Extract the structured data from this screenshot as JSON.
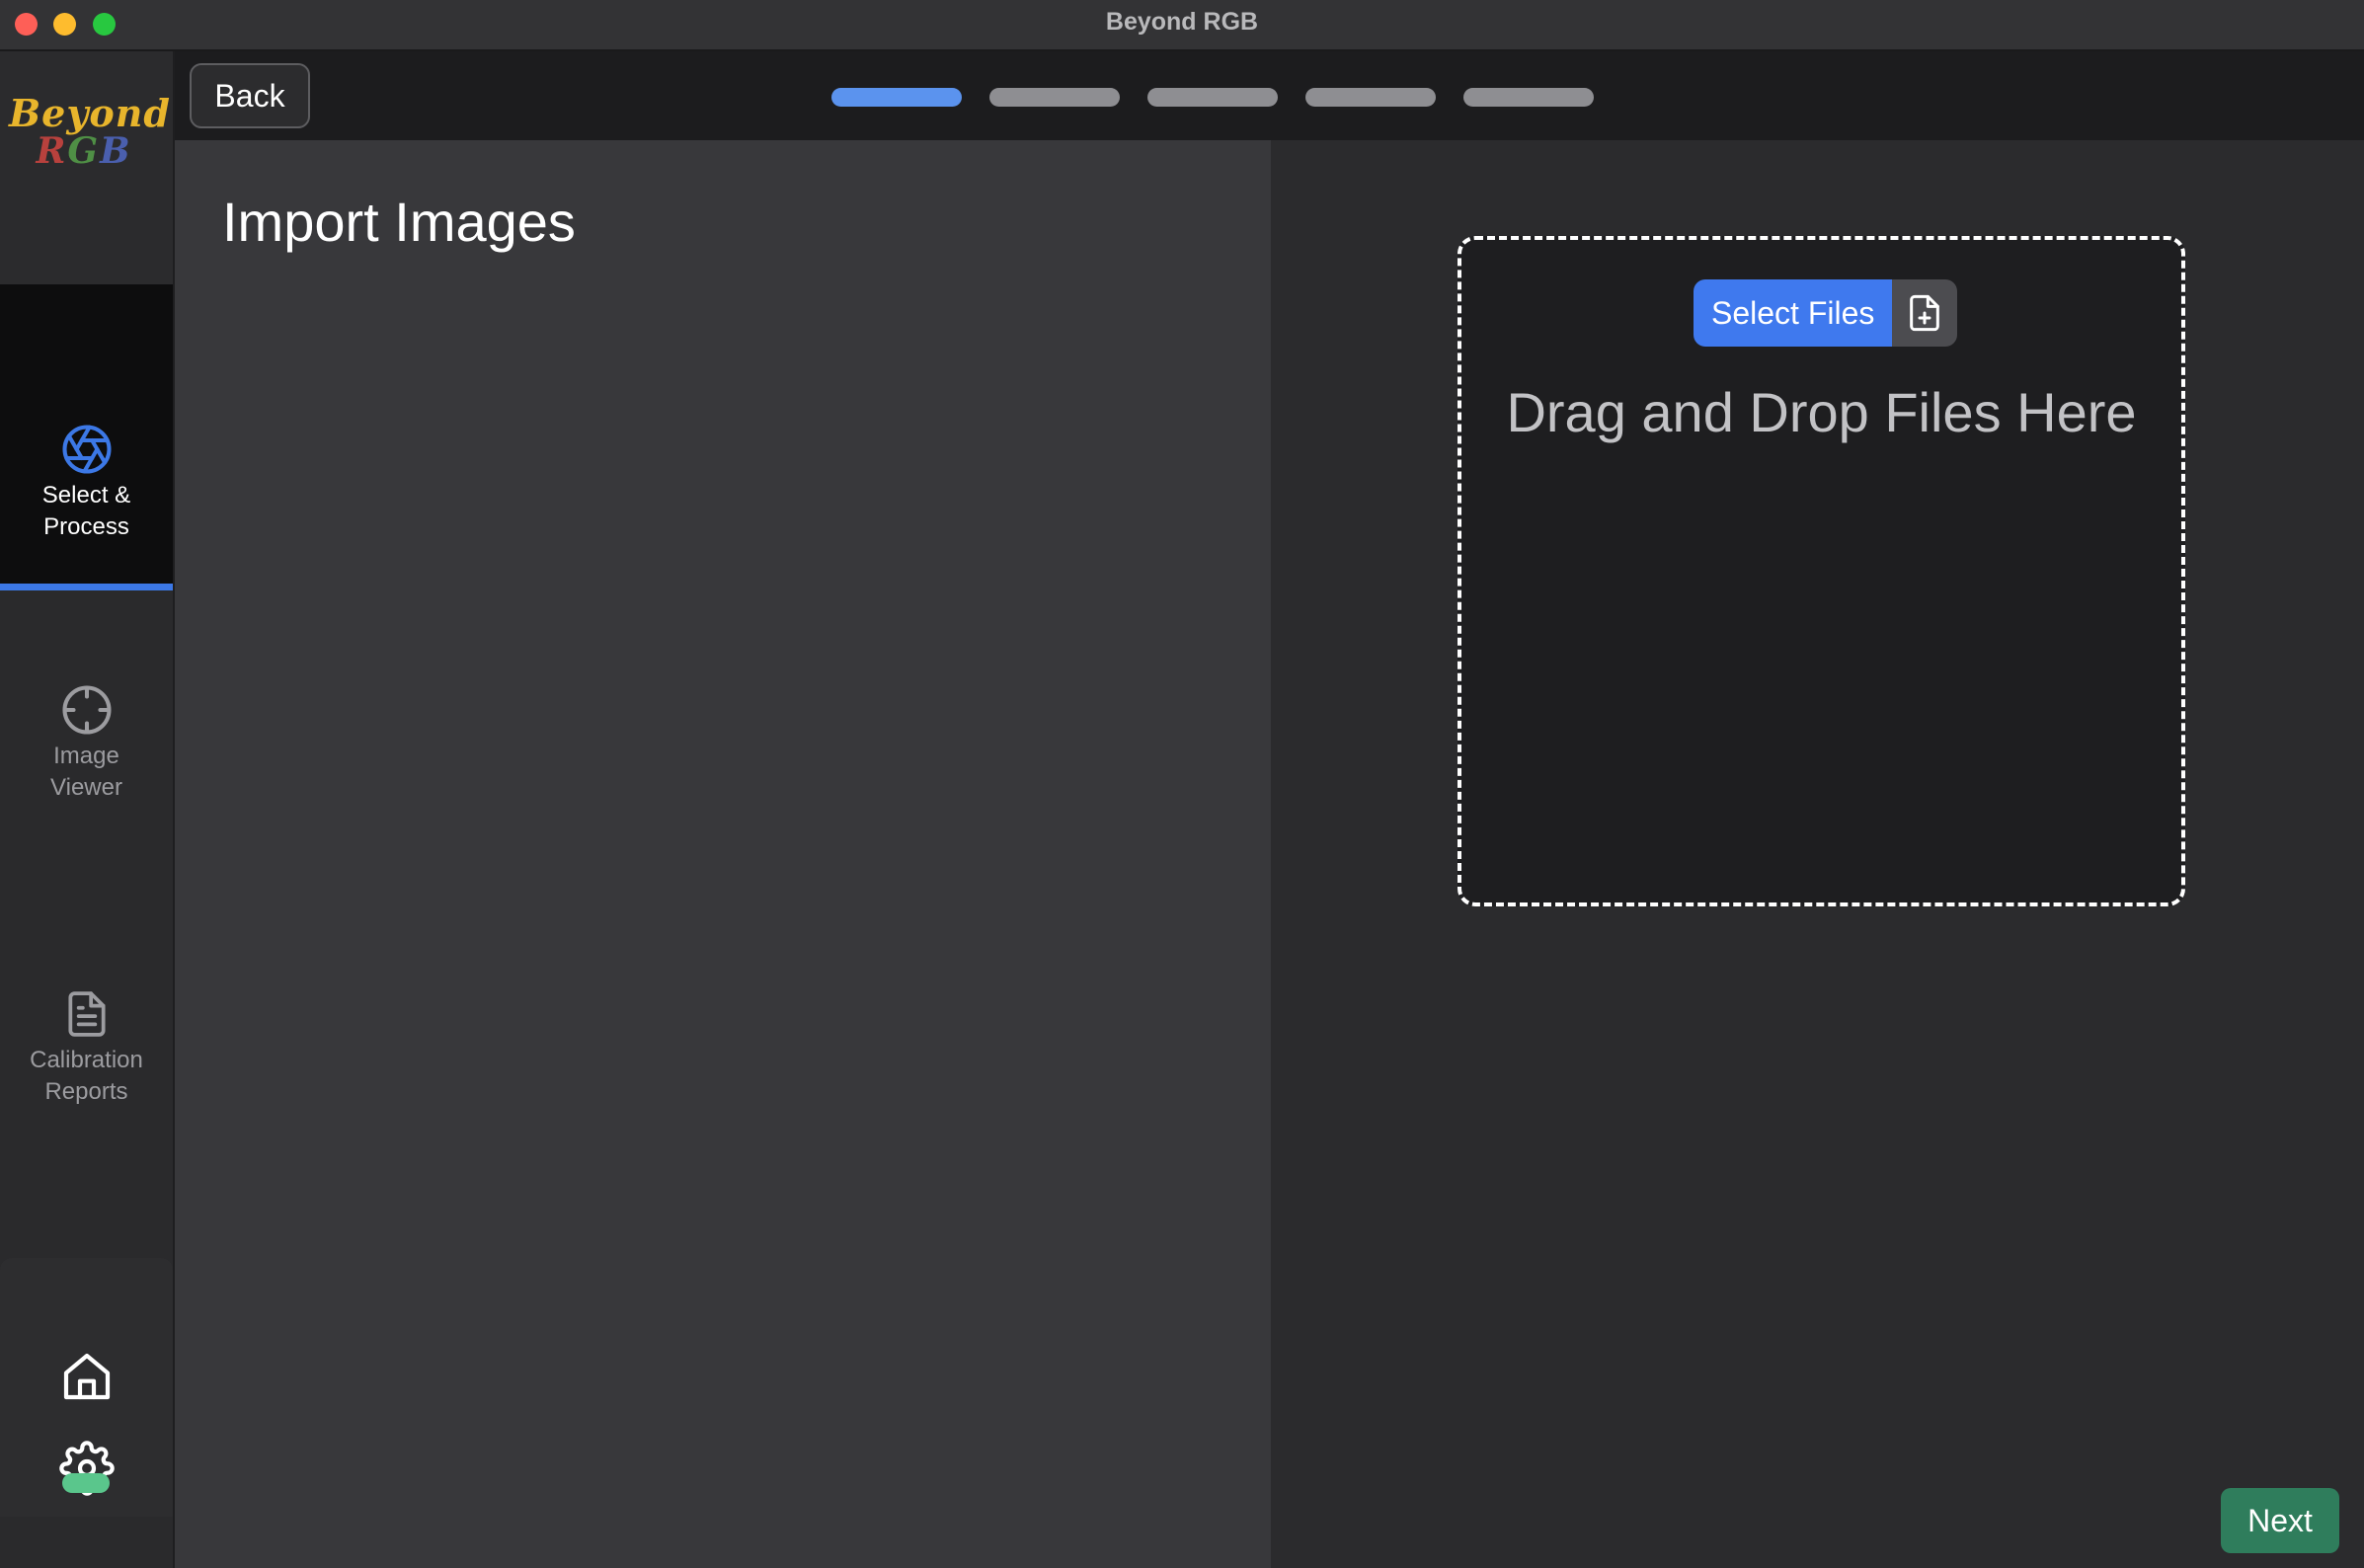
{
  "window": {
    "title": "Beyond RGB",
    "traffic_lights": [
      "close",
      "minimize",
      "zoom"
    ]
  },
  "logo": {
    "line1": "Beyond",
    "line2": {
      "r": "R",
      "g": "G",
      "b": "B"
    }
  },
  "sidebar": {
    "items": [
      {
        "label_line1": "Select &",
        "label_line2": "Process",
        "icon": "aperture-icon",
        "active": true
      },
      {
        "label_line1": "Image",
        "label_line2": "Viewer",
        "icon": "crosshair-icon",
        "active": false
      },
      {
        "label_line1": "Calibration",
        "label_line2": "Reports",
        "icon": "document-icon",
        "active": false
      }
    ],
    "bottom": {
      "home_icon": "home-icon",
      "settings_icon": "gear-icon",
      "status_color": "#5ac68c"
    }
  },
  "topbar": {
    "back_label": "Back",
    "steps": {
      "total": 5,
      "current": 1
    }
  },
  "left_pane": {
    "title": "Import Images"
  },
  "dropzone": {
    "select_label": "Select Files",
    "select_icon": "file-plus-icon",
    "drop_text": "Drag and Drop Files Here"
  },
  "footer": {
    "next_label": "Next"
  },
  "colors": {
    "accent": "#3f79ee",
    "step_active": "#5b93ee",
    "step_inactive": "#8e8e92",
    "next": "#2f7d5c"
  }
}
